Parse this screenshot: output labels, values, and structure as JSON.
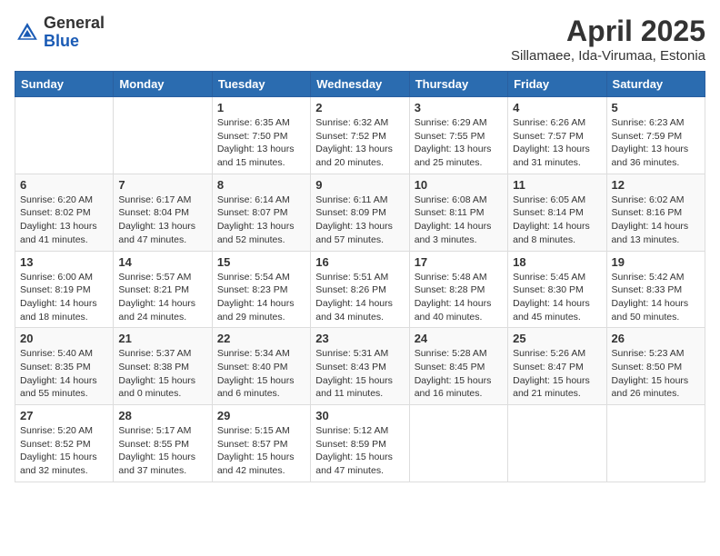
{
  "header": {
    "logo_general": "General",
    "logo_blue": "Blue",
    "title": "April 2025",
    "subtitle": "Sillamaee, Ida-Virumaa, Estonia"
  },
  "days_of_week": [
    "Sunday",
    "Monday",
    "Tuesday",
    "Wednesday",
    "Thursday",
    "Friday",
    "Saturday"
  ],
  "weeks": [
    [
      {
        "day": "",
        "sunrise": "",
        "sunset": "",
        "daylight": ""
      },
      {
        "day": "",
        "sunrise": "",
        "sunset": "",
        "daylight": ""
      },
      {
        "day": "1",
        "sunrise": "Sunrise: 6:35 AM",
        "sunset": "Sunset: 7:50 PM",
        "daylight": "Daylight: 13 hours and 15 minutes."
      },
      {
        "day": "2",
        "sunrise": "Sunrise: 6:32 AM",
        "sunset": "Sunset: 7:52 PM",
        "daylight": "Daylight: 13 hours and 20 minutes."
      },
      {
        "day": "3",
        "sunrise": "Sunrise: 6:29 AM",
        "sunset": "Sunset: 7:55 PM",
        "daylight": "Daylight: 13 hours and 25 minutes."
      },
      {
        "day": "4",
        "sunrise": "Sunrise: 6:26 AM",
        "sunset": "Sunset: 7:57 PM",
        "daylight": "Daylight: 13 hours and 31 minutes."
      },
      {
        "day": "5",
        "sunrise": "Sunrise: 6:23 AM",
        "sunset": "Sunset: 7:59 PM",
        "daylight": "Daylight: 13 hours and 36 minutes."
      }
    ],
    [
      {
        "day": "6",
        "sunrise": "Sunrise: 6:20 AM",
        "sunset": "Sunset: 8:02 PM",
        "daylight": "Daylight: 13 hours and 41 minutes."
      },
      {
        "day": "7",
        "sunrise": "Sunrise: 6:17 AM",
        "sunset": "Sunset: 8:04 PM",
        "daylight": "Daylight: 13 hours and 47 minutes."
      },
      {
        "day": "8",
        "sunrise": "Sunrise: 6:14 AM",
        "sunset": "Sunset: 8:07 PM",
        "daylight": "Daylight: 13 hours and 52 minutes."
      },
      {
        "day": "9",
        "sunrise": "Sunrise: 6:11 AM",
        "sunset": "Sunset: 8:09 PM",
        "daylight": "Daylight: 13 hours and 57 minutes."
      },
      {
        "day": "10",
        "sunrise": "Sunrise: 6:08 AM",
        "sunset": "Sunset: 8:11 PM",
        "daylight": "Daylight: 14 hours and 3 minutes."
      },
      {
        "day": "11",
        "sunrise": "Sunrise: 6:05 AM",
        "sunset": "Sunset: 8:14 PM",
        "daylight": "Daylight: 14 hours and 8 minutes."
      },
      {
        "day": "12",
        "sunrise": "Sunrise: 6:02 AM",
        "sunset": "Sunset: 8:16 PM",
        "daylight": "Daylight: 14 hours and 13 minutes."
      }
    ],
    [
      {
        "day": "13",
        "sunrise": "Sunrise: 6:00 AM",
        "sunset": "Sunset: 8:19 PM",
        "daylight": "Daylight: 14 hours and 18 minutes."
      },
      {
        "day": "14",
        "sunrise": "Sunrise: 5:57 AM",
        "sunset": "Sunset: 8:21 PM",
        "daylight": "Daylight: 14 hours and 24 minutes."
      },
      {
        "day": "15",
        "sunrise": "Sunrise: 5:54 AM",
        "sunset": "Sunset: 8:23 PM",
        "daylight": "Daylight: 14 hours and 29 minutes."
      },
      {
        "day": "16",
        "sunrise": "Sunrise: 5:51 AM",
        "sunset": "Sunset: 8:26 PM",
        "daylight": "Daylight: 14 hours and 34 minutes."
      },
      {
        "day": "17",
        "sunrise": "Sunrise: 5:48 AM",
        "sunset": "Sunset: 8:28 PM",
        "daylight": "Daylight: 14 hours and 40 minutes."
      },
      {
        "day": "18",
        "sunrise": "Sunrise: 5:45 AM",
        "sunset": "Sunset: 8:30 PM",
        "daylight": "Daylight: 14 hours and 45 minutes."
      },
      {
        "day": "19",
        "sunrise": "Sunrise: 5:42 AM",
        "sunset": "Sunset: 8:33 PM",
        "daylight": "Daylight: 14 hours and 50 minutes."
      }
    ],
    [
      {
        "day": "20",
        "sunrise": "Sunrise: 5:40 AM",
        "sunset": "Sunset: 8:35 PM",
        "daylight": "Daylight: 14 hours and 55 minutes."
      },
      {
        "day": "21",
        "sunrise": "Sunrise: 5:37 AM",
        "sunset": "Sunset: 8:38 PM",
        "daylight": "Daylight: 15 hours and 0 minutes."
      },
      {
        "day": "22",
        "sunrise": "Sunrise: 5:34 AM",
        "sunset": "Sunset: 8:40 PM",
        "daylight": "Daylight: 15 hours and 6 minutes."
      },
      {
        "day": "23",
        "sunrise": "Sunrise: 5:31 AM",
        "sunset": "Sunset: 8:43 PM",
        "daylight": "Daylight: 15 hours and 11 minutes."
      },
      {
        "day": "24",
        "sunrise": "Sunrise: 5:28 AM",
        "sunset": "Sunset: 8:45 PM",
        "daylight": "Daylight: 15 hours and 16 minutes."
      },
      {
        "day": "25",
        "sunrise": "Sunrise: 5:26 AM",
        "sunset": "Sunset: 8:47 PM",
        "daylight": "Daylight: 15 hours and 21 minutes."
      },
      {
        "day": "26",
        "sunrise": "Sunrise: 5:23 AM",
        "sunset": "Sunset: 8:50 PM",
        "daylight": "Daylight: 15 hours and 26 minutes."
      }
    ],
    [
      {
        "day": "27",
        "sunrise": "Sunrise: 5:20 AM",
        "sunset": "Sunset: 8:52 PM",
        "daylight": "Daylight: 15 hours and 32 minutes."
      },
      {
        "day": "28",
        "sunrise": "Sunrise: 5:17 AM",
        "sunset": "Sunset: 8:55 PM",
        "daylight": "Daylight: 15 hours and 37 minutes."
      },
      {
        "day": "29",
        "sunrise": "Sunrise: 5:15 AM",
        "sunset": "Sunset: 8:57 PM",
        "daylight": "Daylight: 15 hours and 42 minutes."
      },
      {
        "day": "30",
        "sunrise": "Sunrise: 5:12 AM",
        "sunset": "Sunset: 8:59 PM",
        "daylight": "Daylight: 15 hours and 47 minutes."
      },
      {
        "day": "",
        "sunrise": "",
        "sunset": "",
        "daylight": ""
      },
      {
        "day": "",
        "sunrise": "",
        "sunset": "",
        "daylight": ""
      },
      {
        "day": "",
        "sunrise": "",
        "sunset": "",
        "daylight": ""
      }
    ]
  ]
}
